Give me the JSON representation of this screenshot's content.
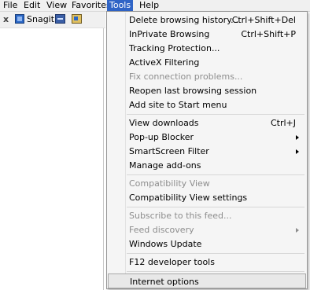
{
  "menubar": {
    "items": [
      {
        "label": "File"
      },
      {
        "label": "Edit"
      },
      {
        "label": "View"
      },
      {
        "label": "Favorites"
      },
      {
        "label": "Tools"
      },
      {
        "label": "Help"
      }
    ]
  },
  "toolbar": {
    "close_glyph": "x",
    "snagit_label": "Snagit"
  },
  "tools_menu": {
    "items": [
      {
        "label": "Delete browsing history...",
        "shortcut": "Ctrl+Shift+Del"
      },
      {
        "label": "InPrivate Browsing",
        "shortcut": "Ctrl+Shift+P"
      },
      {
        "label": "Tracking Protection..."
      },
      {
        "label": "ActiveX Filtering"
      },
      {
        "label": "Fix connection problems...",
        "disabled": true
      },
      {
        "label": "Reopen last browsing session"
      },
      {
        "label": "Add site to Start menu"
      },
      {
        "label": "View downloads",
        "shortcut": "Ctrl+J"
      },
      {
        "label": "Pop-up Blocker",
        "submenu": true
      },
      {
        "label": "SmartScreen Filter",
        "submenu": true
      },
      {
        "label": "Manage add-ons"
      },
      {
        "label": "Compatibility View",
        "disabled": true
      },
      {
        "label": "Compatibility View settings"
      },
      {
        "label": "Subscribe to this feed...",
        "disabled": true
      },
      {
        "label": "Feed discovery",
        "disabled": true,
        "submenu": true
      },
      {
        "label": "Windows Update"
      },
      {
        "label": "F12 developer tools"
      },
      {
        "label": "Internet options",
        "highlighted": true
      }
    ]
  },
  "colors": {
    "menu_active": "#2f64c6",
    "menu_bg": "#f5f5f5",
    "disabled_text": "#8d8d8d"
  }
}
